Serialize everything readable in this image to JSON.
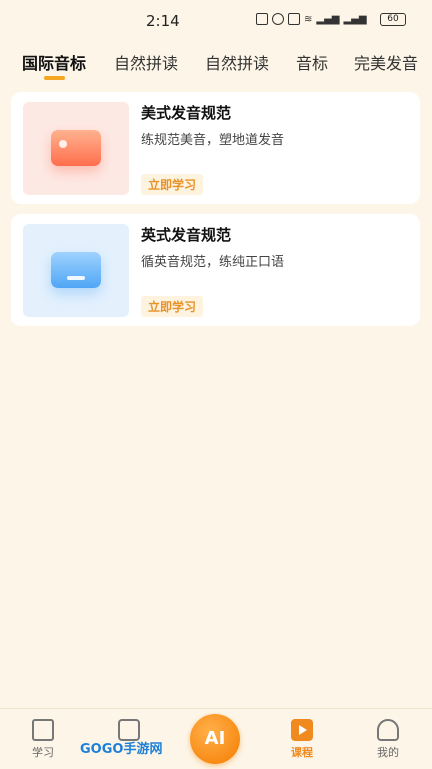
{
  "status": {
    "time": "2:14",
    "battery": "60"
  },
  "tabs": [
    {
      "label": "国际音标"
    },
    {
      "label": "自然拼读"
    },
    {
      "label": "自然拼读"
    },
    {
      "label": "音标"
    },
    {
      "label": "完美发音"
    }
  ],
  "courses": [
    {
      "title": "美式发音规范",
      "subtitle": "练规范美音，塑地道发音",
      "button": "立即学习",
      "accent": "#ff6e4d"
    },
    {
      "title": "英式发音规范",
      "subtitle": "循英音规范，练纯正口语",
      "button": "立即学习",
      "accent": "#4fa6f5"
    }
  ],
  "nav": {
    "study": "学习",
    "ai": "AI",
    "course": "课程",
    "mine": "我的"
  },
  "watermark": "GOGO手游网"
}
